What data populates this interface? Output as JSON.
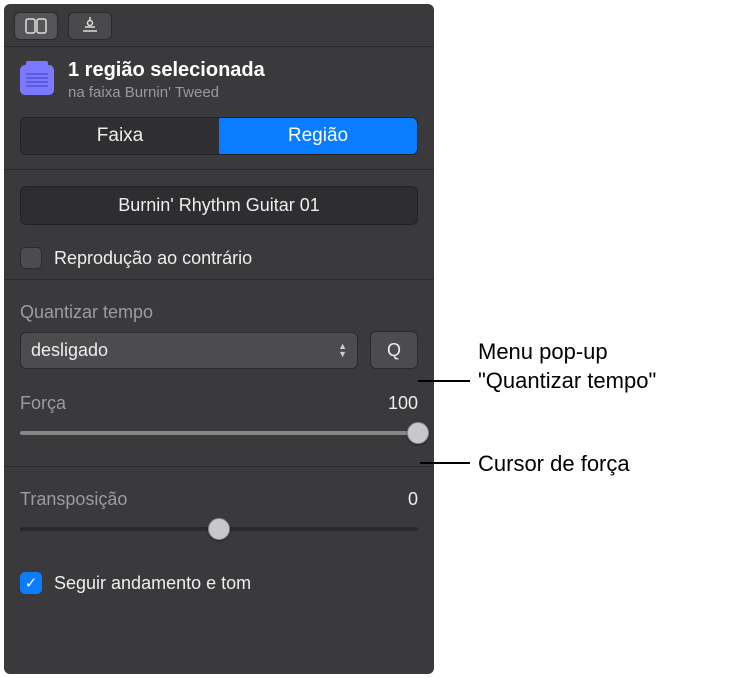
{
  "header": {
    "title": "1 região selecionada",
    "subtitle": "na faixa Burnin' Tweed"
  },
  "seg": {
    "track": "Faixa",
    "region": "Região"
  },
  "region_name": "Burnin' Rhythm Guitar 01",
  "reverse": {
    "label": "Reprodução ao contrário",
    "checked": false
  },
  "quantize": {
    "section_label": "Quantizar tempo",
    "value": "desligado",
    "q_button": "Q"
  },
  "strength": {
    "label": "Força",
    "value": "100",
    "percent": 100
  },
  "transpose": {
    "label": "Transposição",
    "value": "0",
    "percent": 50
  },
  "follow": {
    "label": "Seguir andamento e tom",
    "checked": true
  },
  "callouts": {
    "quantize_menu": "Menu pop-up \"Quantizar tempo\"",
    "strength_slider": "Cursor de força"
  }
}
